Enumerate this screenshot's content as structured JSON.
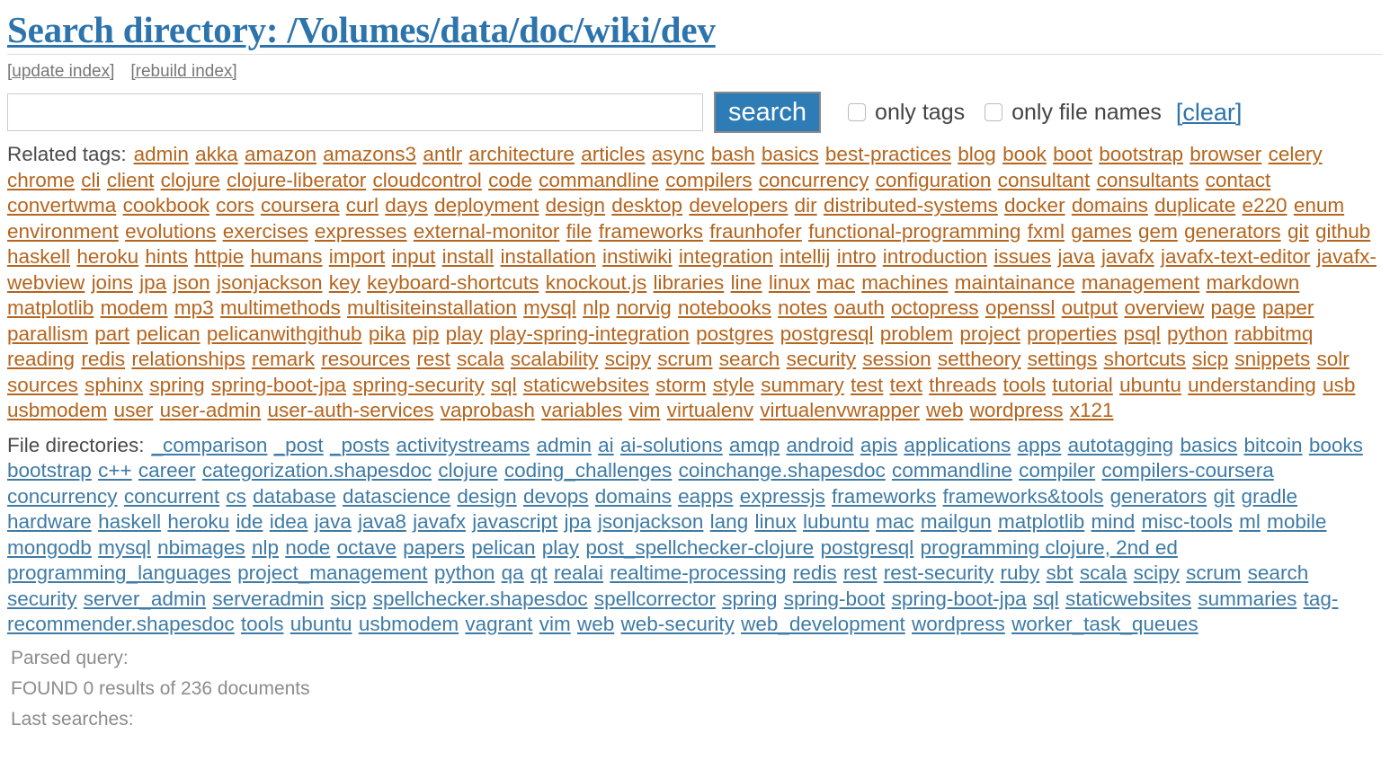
{
  "header": {
    "title_prefix": "Search directory: ",
    "title_path": "/Volumes/data/doc/wiki/dev",
    "title_full": "Search directory: /Volumes/data/doc/wiki/dev"
  },
  "index_actions": [
    {
      "label": "[update index]",
      "name": "update-index-link"
    },
    {
      "label": "[rebuild index]",
      "name": "rebuild-index-link"
    }
  ],
  "search": {
    "value": "",
    "placeholder": "",
    "button_label": "search",
    "only_tags_label": "only tags",
    "only_tags_checked": false,
    "only_file_names_label": "only file names",
    "only_file_names_checked": false,
    "clear_label": "[clear]"
  },
  "related_tags": {
    "lead": "Related tags:",
    "items": [
      "admin",
      "akka",
      "amazon",
      "amazons3",
      "antlr",
      "architecture",
      "articles",
      "async",
      "bash",
      "basics",
      "best-practices",
      "blog",
      "book",
      "boot",
      "bootstrap",
      "browser",
      "celery",
      "chrome",
      "cli",
      "client",
      "clojure",
      "clojure-liberator",
      "cloudcontrol",
      "code",
      "commandline",
      "compilers",
      "concurrency",
      "configuration",
      "consultant",
      "consultants",
      "contact",
      "convertwma",
      "cookbook",
      "cors",
      "coursera",
      "curl",
      "days",
      "deployment",
      "design",
      "desktop",
      "developers",
      "dir",
      "distributed-systems",
      "docker",
      "domains",
      "duplicate",
      "e220",
      "enum",
      "environment",
      "evolutions",
      "exercises",
      "expresses",
      "external-monitor",
      "file",
      "frameworks",
      "fraunhofer",
      "functional-programming",
      "fxml",
      "games",
      "gem",
      "generators",
      "git",
      "github",
      "haskell",
      "heroku",
      "hints",
      "httpie",
      "humans",
      "import",
      "input",
      "install",
      "installation",
      "instiwiki",
      "integration",
      "intellij",
      "intro",
      "introduction",
      "issues",
      "java",
      "javafx",
      "javafx-text-editor",
      "javafx-webview",
      "joins",
      "jpa",
      "json",
      "jsonjackson",
      "key",
      "keyboard-shortcuts",
      "knockout.js",
      "libraries",
      "line",
      "linux",
      "mac",
      "machines",
      "maintainance",
      "management",
      "markdown",
      "matplotlib",
      "modem",
      "mp3",
      "multimethods",
      "multisiteinstallation",
      "mysql",
      "nlp",
      "norvig",
      "notebooks",
      "notes",
      "oauth",
      "octopress",
      "openssl",
      "output",
      "overview",
      "page",
      "paper",
      "parallism",
      "part",
      "pelican",
      "pelicanwithgithub",
      "pika",
      "pip",
      "play",
      "play-spring-integration",
      "postgres",
      "postgresql",
      "problem",
      "project",
      "properties",
      "psql",
      "python",
      "rabbitmq",
      "reading",
      "redis",
      "relationships",
      "remark",
      "resources",
      "rest",
      "scala",
      "scalability",
      "scipy",
      "scrum",
      "search",
      "security",
      "session",
      "settheory",
      "settings",
      "shortcuts",
      "sicp",
      "snippets",
      "solr",
      "sources",
      "sphinx",
      "spring",
      "spring-boot-jpa",
      "spring-security",
      "sql",
      "staticwebsites",
      "storm",
      "style",
      "summary",
      "test",
      "text",
      "threads",
      "tools",
      "tutorial",
      "ubuntu",
      "understanding",
      "usb",
      "usbmodem",
      "user",
      "user-admin",
      "user-auth-services",
      "vaprobash",
      "variables",
      "vim",
      "virtualenv",
      "virtualenvwrapper",
      "web",
      "wordpress",
      "x121"
    ]
  },
  "file_directories": {
    "lead": "File directories:",
    "items": [
      "_comparison",
      "_post",
      "_posts",
      "activitystreams",
      "admin",
      "ai",
      "ai-solutions",
      "amqp",
      "android",
      "apis",
      "applications",
      "apps",
      "autotagging",
      "basics",
      "bitcoin",
      "books",
      "bootstrap",
      "c++",
      "career",
      "categorization.shapesdoc",
      "clojure",
      "coding_challenges",
      "coinchange.shapesdoc",
      "commandline",
      "compiler",
      "compilers-coursera",
      "concurrency",
      "concurrent",
      "cs",
      "database",
      "datascience",
      "design",
      "devops",
      "domains",
      "eapps",
      "expressjs",
      "frameworks",
      "frameworks&tools",
      "generators",
      "git",
      "gradle",
      "hardware",
      "haskell",
      "heroku",
      "ide",
      "idea",
      "java",
      "java8",
      "javafx",
      "javascript",
      "jpa",
      "jsonjackson",
      "lang",
      "linux",
      "lubuntu",
      "mac",
      "mailgun",
      "matplotlib",
      "mind",
      "misc-tools",
      "ml",
      "mobile",
      "mongodb",
      "mysql",
      "nbimages",
      "nlp",
      "node",
      "octave",
      "papers",
      "pelican",
      "play",
      "post_spellchecker-clojure",
      "postgresql",
      "programming clojure, 2nd ed",
      "programming_languages",
      "project_management",
      "python",
      "qa",
      "qt",
      "realai",
      "realtime-processing",
      "redis",
      "rest",
      "rest-security",
      "ruby",
      "sbt",
      "scala",
      "scipy",
      "scrum",
      "search",
      "security",
      "server_admin",
      "serveradmin",
      "sicp",
      "spellchecker.shapesdoc",
      "spellcorrector",
      "spring",
      "spring-boot",
      "spring-boot-jpa",
      "sql",
      "staticwebsites",
      "summaries",
      "tag-recommender.shapesdoc",
      "tools",
      "ubuntu",
      "usbmodem",
      "vagrant",
      "vim",
      "web",
      "web-security",
      "web_development",
      "wordpress",
      "worker_task_queues"
    ]
  },
  "status": {
    "parsed_query_label": "Parsed query:",
    "found_line": "FOUND 0 results of 236 documents",
    "last_searches_label": "Last searches:"
  },
  "colors": {
    "title_blue": "#2d74ad",
    "tag_orange": "#b5651d",
    "dir_blue": "#3e7ba6",
    "button_blue": "#2e7cb6",
    "status_gray": "#8c8c8c"
  }
}
